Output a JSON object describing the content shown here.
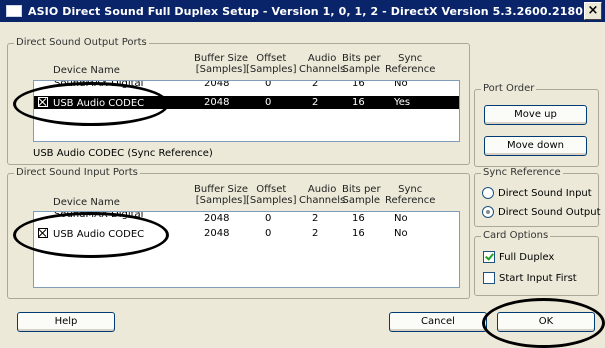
{
  "window": {
    "title": "ASIO Direct Sound Full Duplex Setup   - Version 1, 0, 1, 2  - DirectX Version 5.3.2600.2180 ...",
    "close_glyph": "×"
  },
  "columns": {
    "device_name": "Device Name",
    "buffer_size": [
      "Buffer Size",
      "[Samples]"
    ],
    "offset": [
      "Offset",
      "[Samples]"
    ],
    "audio_channels": [
      "Audio",
      "Channels"
    ],
    "bits_per_sample": [
      "Bits per",
      "Sample"
    ],
    "sync_reference": [
      "Sync",
      "Reference"
    ]
  },
  "output_ports": {
    "title": "Direct Sound Output Ports",
    "rows": [
      {
        "name": "SoundMAX Digital",
        "buffer": "2048",
        "offset": "0",
        "channels": "2",
        "bits": "16",
        "sync": "No",
        "selected": false
      },
      {
        "name": "USB Audio CODEC",
        "buffer": "2048",
        "offset": "0",
        "channels": "2",
        "bits": "16",
        "sync": "Yes",
        "selected": true
      }
    ],
    "sync_label": "USB Audio CODEC  (Sync Reference)"
  },
  "input_ports": {
    "title": "Direct Sound Input Ports",
    "rows": [
      {
        "name": "SoundMAX Digital",
        "buffer": "2048",
        "offset": "0",
        "channels": "2",
        "bits": "16",
        "sync": "No",
        "selected": false
      },
      {
        "name": "USB Audio CODEC",
        "buffer": "2048",
        "offset": "0",
        "channels": "2",
        "bits": "16",
        "sync": "No",
        "selected": false
      }
    ]
  },
  "port_order": {
    "title": "Port Order",
    "move_up": "Move up",
    "move_down": "Move down"
  },
  "sync_reference": {
    "title": "Sync Reference",
    "options": [
      "Direct Sound Input",
      "Direct Sound Output"
    ],
    "selected_index": 1
  },
  "card_options": {
    "title": "Card Options",
    "full_duplex": "Full Duplex",
    "full_duplex_checked": true,
    "start_input_first": "Start Input First",
    "start_input_first_checked": false
  },
  "buttons": {
    "help": "Help",
    "cancel": "Cancel",
    "ok": "OK"
  }
}
